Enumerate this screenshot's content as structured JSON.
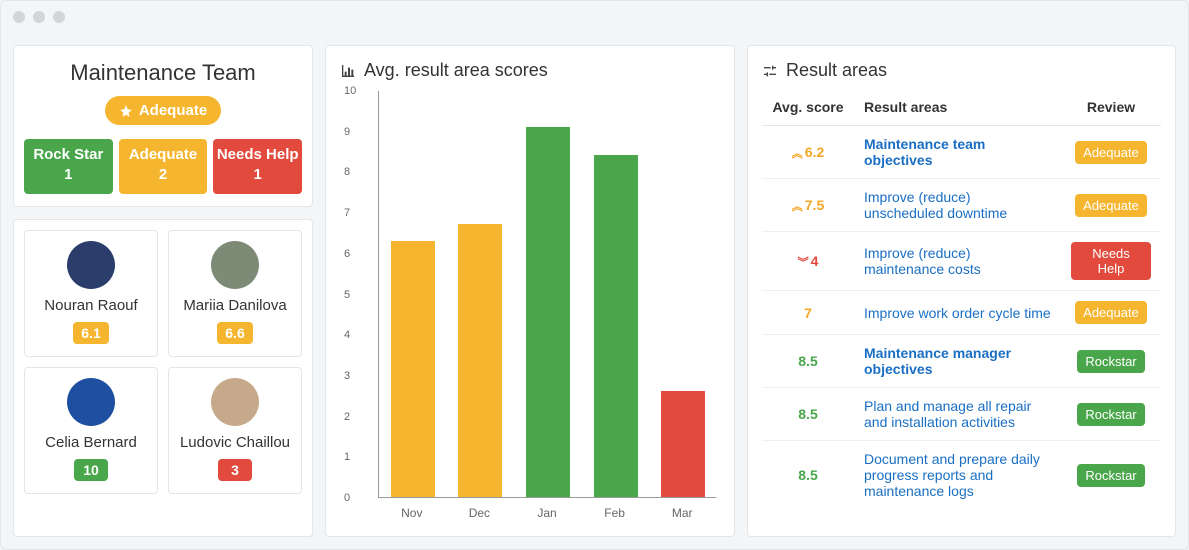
{
  "colors": {
    "green": "#4aa64a",
    "amber": "#f5b52e",
    "red": "#e14a3d"
  },
  "team": {
    "title": "Maintenance Team",
    "overall_badge": "Adequate",
    "summary": [
      {
        "label": "Rock Star",
        "count": "1",
        "color": "green"
      },
      {
        "label": "Adequate",
        "count": "2",
        "color": "amber"
      },
      {
        "label": "Needs Help",
        "count": "1",
        "color": "red"
      }
    ],
    "people": [
      {
        "name": "Nouran Raouf",
        "score": "6.1",
        "color": "amber"
      },
      {
        "name": "Mariia Danilova",
        "score": "6.6",
        "color": "amber"
      },
      {
        "name": "Celia Bernard",
        "score": "10",
        "color": "green"
      },
      {
        "name": "Ludovic Chaillou",
        "score": "3",
        "color": "red"
      }
    ]
  },
  "chart_panel": {
    "title": "Avg. result area scores"
  },
  "chart_data": {
    "type": "bar",
    "title": "Avg. result area scores",
    "xlabel": "",
    "ylabel": "",
    "ylim": [
      0,
      10
    ],
    "yticks": [
      0,
      1,
      2,
      3,
      4,
      5,
      6,
      7,
      8,
      9,
      10
    ],
    "categories": [
      "Nov",
      "Dec",
      "Jan",
      "Feb",
      "Mar"
    ],
    "values": [
      6.3,
      6.7,
      9.1,
      8.4,
      2.6
    ],
    "bar_colors": [
      "amber",
      "amber",
      "green",
      "green",
      "red"
    ]
  },
  "result_panel": {
    "title": "Result areas"
  },
  "result_headers": {
    "score": "Avg. score",
    "area": "Result areas",
    "review": "Review"
  },
  "result_rows": [
    {
      "score": "6.2",
      "arrow": "up",
      "score_class": "score-amber",
      "area": "Maintenance team objectives",
      "bold": true,
      "review": "Adequate",
      "review_color": "amber"
    },
    {
      "score": "7.5",
      "arrow": "up",
      "score_class": "score-amber",
      "area": "Improve (reduce) unscheduled downtime",
      "bold": false,
      "review": "Adequate",
      "review_color": "amber"
    },
    {
      "score": "4",
      "arrow": "down",
      "score_class": "score-red",
      "area": "Improve (reduce) maintenance costs",
      "bold": false,
      "review": "Needs Help",
      "review_color": "red"
    },
    {
      "score": "7",
      "arrow": "",
      "score_class": "score-amber",
      "area": "Improve work order cycle time",
      "bold": false,
      "review": "Adequate",
      "review_color": "amber"
    },
    {
      "score": "8.5",
      "arrow": "",
      "score_class": "score-green",
      "area": "Maintenance manager objectives",
      "bold": true,
      "review": "Rockstar",
      "review_color": "green"
    },
    {
      "score": "8.5",
      "arrow": "",
      "score_class": "score-green",
      "area": "Plan and manage all repair and installation activities",
      "bold": false,
      "review": "Rockstar",
      "review_color": "green"
    },
    {
      "score": "8.5",
      "arrow": "",
      "score_class": "score-green",
      "area": "Document and prepare daily progress reports and maintenance logs",
      "bold": false,
      "review": "Rockstar",
      "review_color": "green"
    }
  ]
}
